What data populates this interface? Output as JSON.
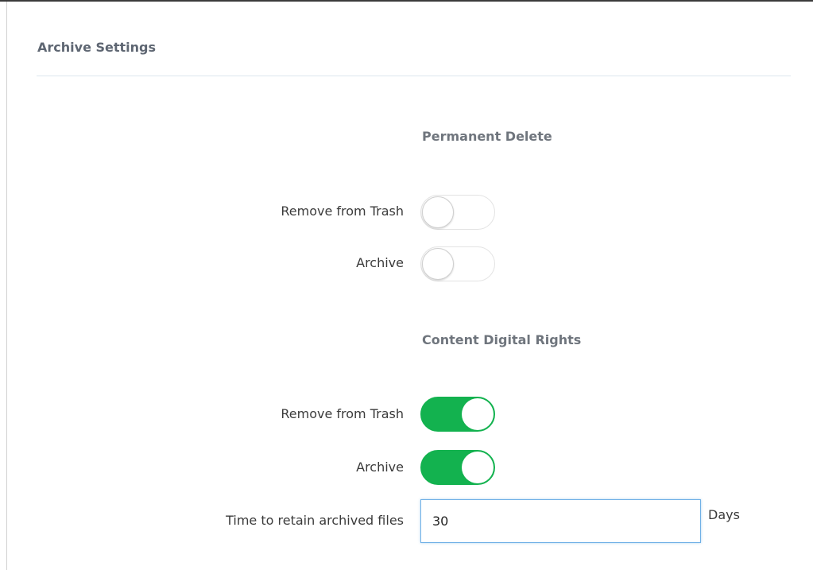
{
  "panel": {
    "title": "Archive Settings"
  },
  "permanent_delete": {
    "heading": "Permanent Delete",
    "rows": [
      {
        "label": "Remove from Trash",
        "enabled": false
      },
      {
        "label": "Archive",
        "enabled": false
      }
    ]
  },
  "content_digital_rights": {
    "heading": "Content Digital Rights",
    "rows": [
      {
        "label": "Remove from Trash",
        "enabled": true
      },
      {
        "label": "Archive",
        "enabled": true
      }
    ]
  },
  "retention": {
    "label": "Time to retain archived files",
    "value": "30",
    "unit": "Days"
  },
  "colors": {
    "toggle_on": "#13b24f",
    "heading_text": "#6f757d",
    "input_focus_border": "#6fb0e6"
  }
}
